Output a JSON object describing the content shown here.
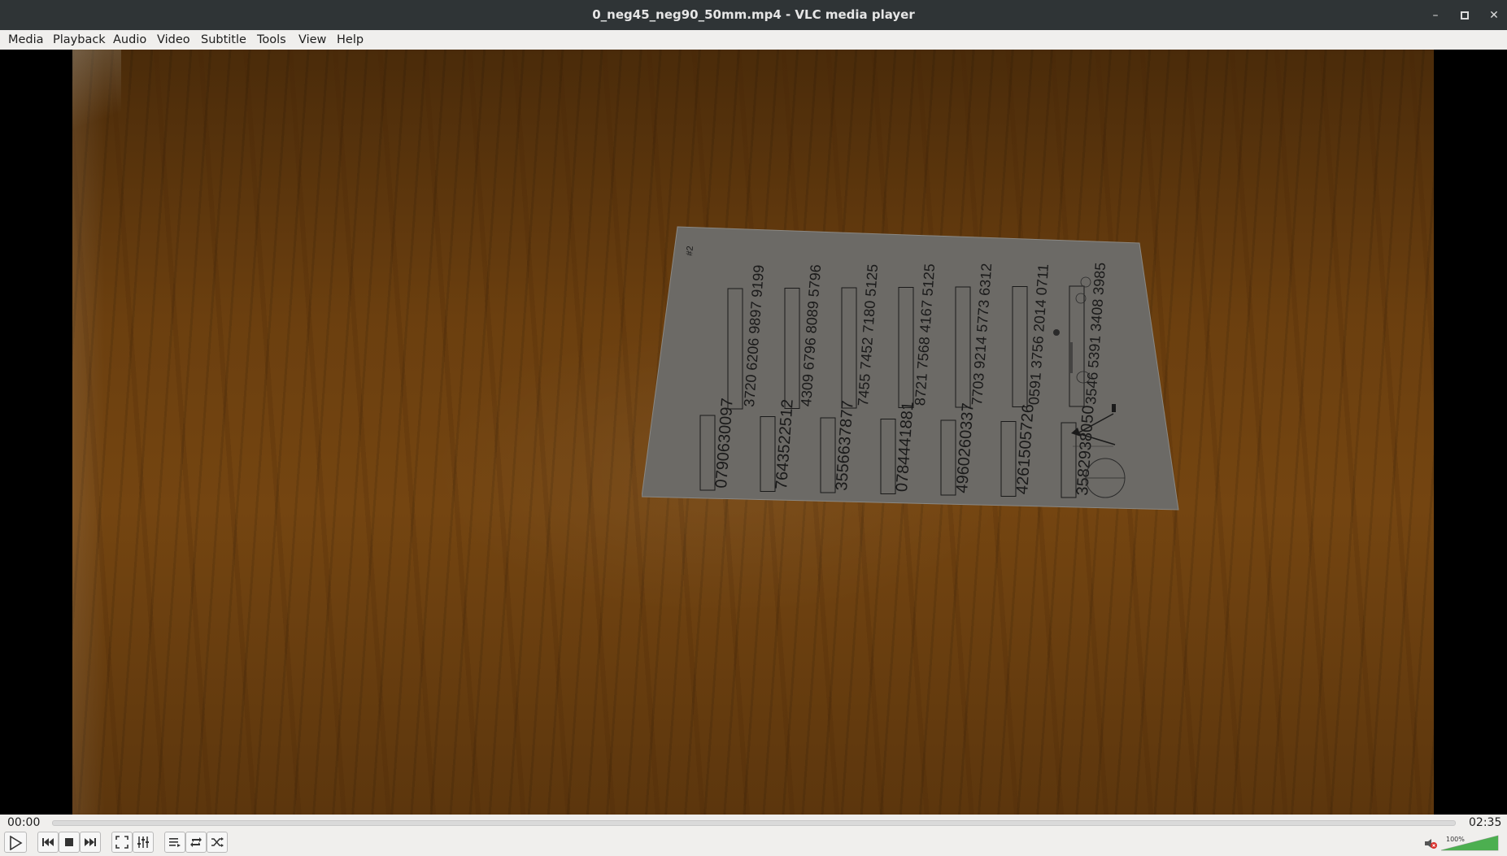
{
  "window": {
    "title": "0_neg45_neg90_50mm.mp4 - VLC media player",
    "minimize_icon": "minimize-icon",
    "maximize_icon": "maximize-icon",
    "close_icon": "close-icon"
  },
  "menu": {
    "items": [
      {
        "label": "Media"
      },
      {
        "label": "Playback"
      },
      {
        "label": "Audio"
      },
      {
        "label": "Video"
      },
      {
        "label": "Subtitle"
      },
      {
        "label": "Tools"
      },
      {
        "label": "View"
      },
      {
        "label": "Help"
      }
    ]
  },
  "video": {
    "sheet": {
      "number_codes": [
        "0790630097",
        "7643522512",
        "3556637877",
        "0784441881",
        "4960260337",
        "4261505726",
        "3582938050"
      ],
      "group_codes": [
        "3720 6206 9897 9199",
        "4309 6796 8089 5796",
        "7455 7452 7180 5125",
        "8721 7568 4167 5125",
        "7703 9214 5773 6312",
        "0591 3756 2014 0711",
        "3546 5391 3408 3985"
      ],
      "corner_mark": "#2"
    }
  },
  "player": {
    "elapsed": "00:00",
    "duration": "02:35",
    "progress_fraction": 0.0,
    "volume_label": "100%",
    "volume_fraction": 1.0
  },
  "controls": {
    "play": "play-icon",
    "previous": "previous-icon",
    "stop": "stop-icon",
    "next": "next-icon",
    "fullscreen": "fullscreen-icon",
    "extended_settings": "equalizer-icon",
    "playlist": "playlist-icon",
    "loop": "loop-icon",
    "shuffle": "shuffle-icon",
    "mute": "muted-speaker-icon"
  }
}
